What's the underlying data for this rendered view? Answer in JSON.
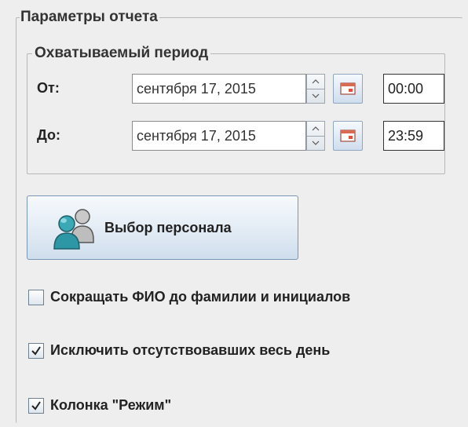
{
  "report_params": {
    "title": "Параметры отчета",
    "period": {
      "title": "Охватываемый период",
      "from": {
        "label": "От:",
        "date": "сентября 17, 2015",
        "time": "00:00"
      },
      "to": {
        "label": "До:",
        "date": "сентября 17, 2015",
        "time": "23:59"
      }
    },
    "staff_button": {
      "label": "Выбор персонала",
      "icon": "users-icon"
    },
    "options": [
      {
        "label": "Сокращать ФИО до фамилии и инициалов",
        "checked": false
      },
      {
        "label": "Исключить отсутствовавших весь день",
        "checked": true
      },
      {
        "label": "Колонка \"Режим\"",
        "checked": true
      }
    ]
  },
  "colors": {
    "panel_bg": "#eeeeee",
    "button_border": "#7a96b4",
    "field_border": "#8c8c8c"
  }
}
